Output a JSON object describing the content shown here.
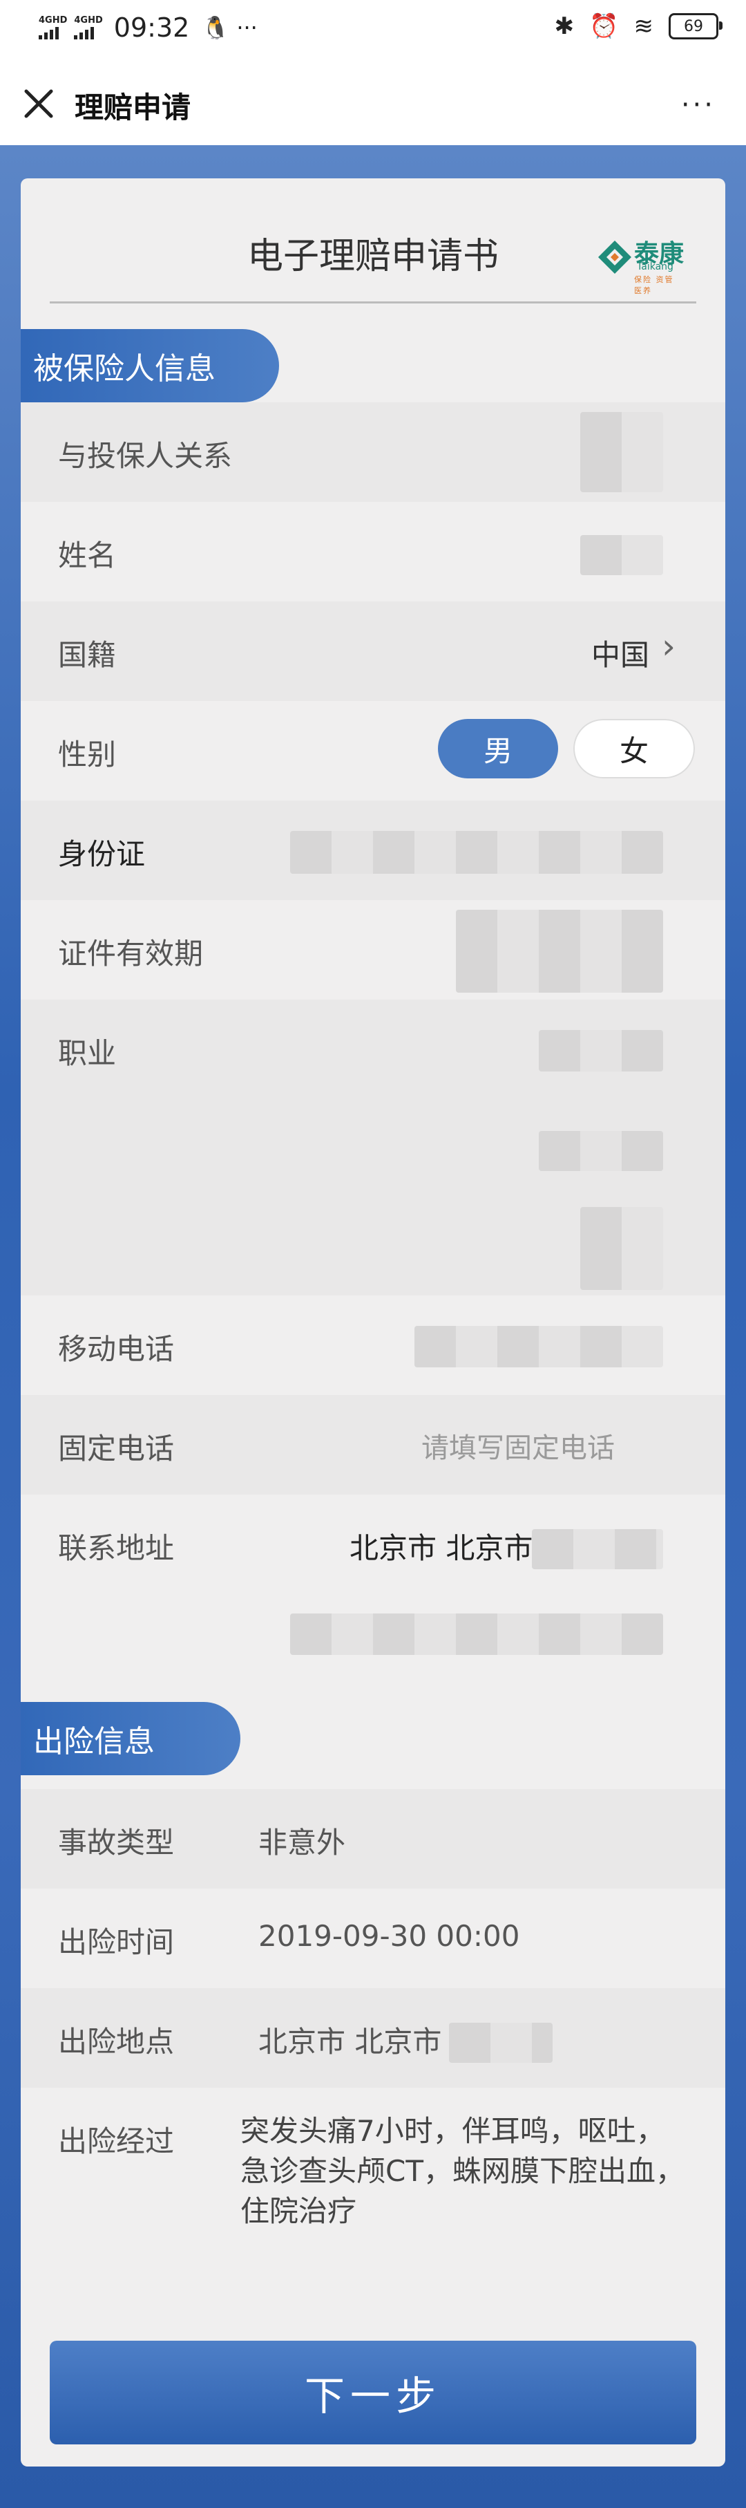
{
  "status_bar": {
    "signal1": "4GHD",
    "signal2": "4GHD",
    "time": "09:32",
    "extra_icons": "🐧 ···",
    "bluetooth": "✱",
    "alarm": "⏰",
    "wifi": "≋",
    "battery": "69"
  },
  "title_bar": {
    "close_icon": "close-icon",
    "title": "理赔申请",
    "more": "···"
  },
  "form": {
    "title": "电子理赔申请书",
    "logo": {
      "cn": "泰康",
      "en": "Taikang",
      "slogan": "保险 资管 医养"
    },
    "insured_section": "被保险人信息",
    "incident_section": "出险信息",
    "rows": {
      "relation": {
        "label": "与投保人关系"
      },
      "name": {
        "label": "姓名"
      },
      "nationality": {
        "label": "国籍",
        "value": "中国"
      },
      "gender": {
        "label": "性别",
        "male": "男",
        "female": "女",
        "selected": "男"
      },
      "id_card": {
        "label": "身份证"
      },
      "id_validity": {
        "label": "证件有效期"
      },
      "occupation": {
        "label": "职业"
      },
      "mobile": {
        "label": "移动电话"
      },
      "landline": {
        "label": "固定电话",
        "placeholder": "请填写固定电话"
      },
      "address": {
        "label": "联系地址",
        "value": "北京市 北京市"
      },
      "accident_type": {
        "label": "事故类型",
        "value": "非意外"
      },
      "incident_time": {
        "label": "出险时间",
        "value": "2019-09-30 00:00"
      },
      "incident_place": {
        "label": "出险地点",
        "value": "北京市 北京市"
      },
      "incident_detail": {
        "label": "出险经过",
        "value": "突发头痛7小时，伴耳鸣，呕吐，急诊查头颅CT，蛛网膜下腔出血，住院治疗"
      }
    },
    "next_button": "下一步"
  }
}
